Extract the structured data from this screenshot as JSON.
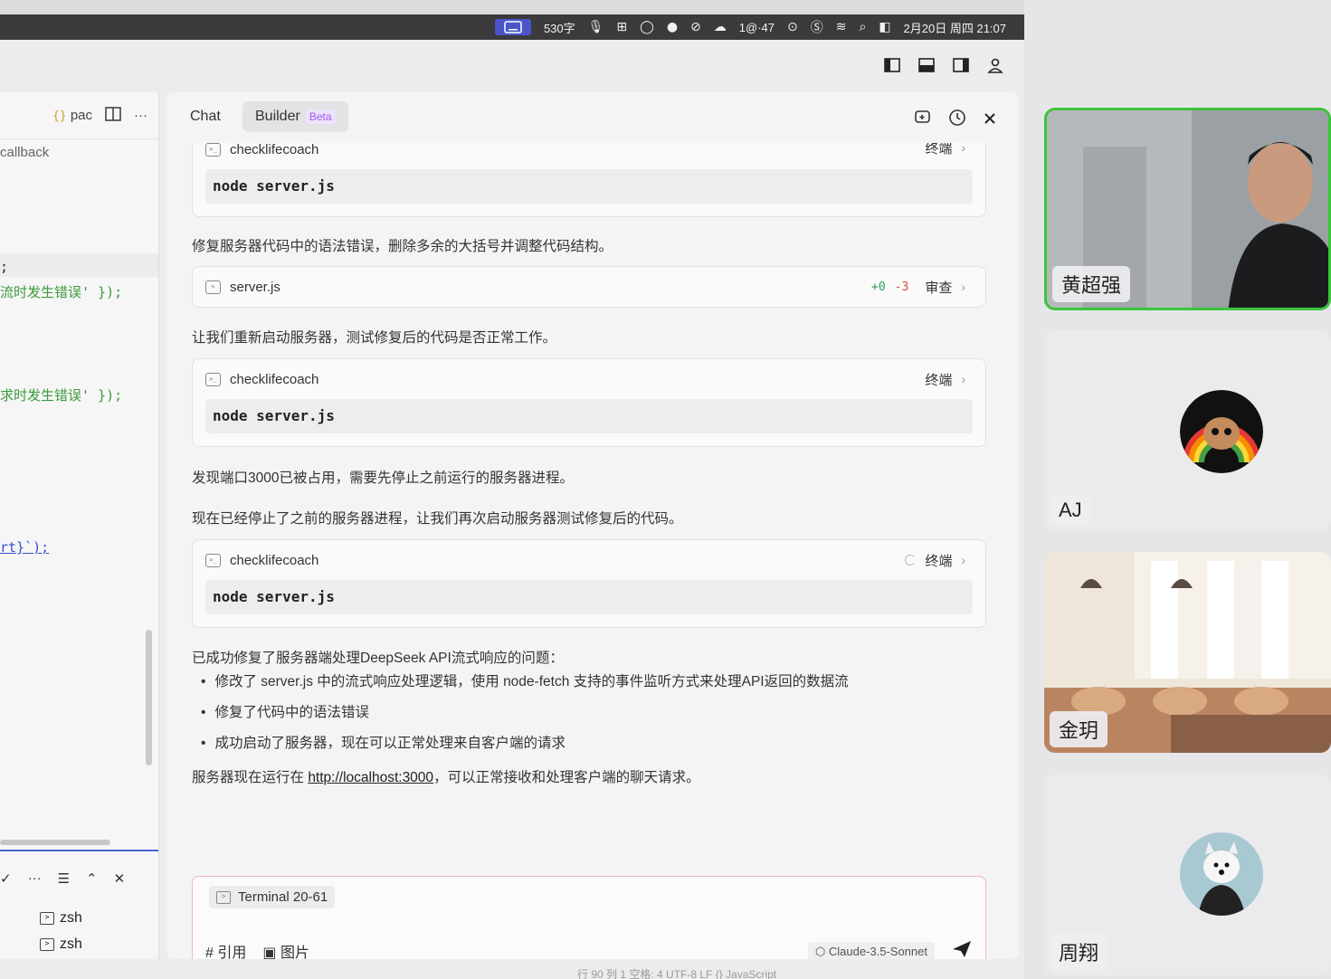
{
  "menubar": {
    "ime_label": "",
    "char_count": "530字",
    "mail_count": "1@·47",
    "datetime": "2月20日 周四  21:07"
  },
  "editor": {
    "tab_label": "pac",
    "breadcrumb": "callback",
    "code_lines": [
      {
        "text": ";",
        "cls": ""
      },
      {
        "text": "流时发生错误' });",
        "cls": "str"
      },
      {
        "text": "求时发生错误' });",
        "cls": "str"
      },
      {
        "text": "rt}`);",
        "cls": "punc"
      }
    ],
    "terminals": [
      "zsh",
      "zsh"
    ]
  },
  "chat": {
    "tabs": {
      "chat": "Chat",
      "builder": "Builder",
      "beta": "Beta"
    },
    "card0": {
      "title": "checklifecoach",
      "action": "终端",
      "code": "node server.js"
    },
    "msg1": "修复服务器代码中的语法错误，删除多余的大括号并调整代码结构。",
    "card1": {
      "title": "server.js",
      "added": "+0",
      "removed": "-3",
      "action": "审查"
    },
    "msg2": "让我们重新启动服务器，测试修复后的代码是否正常工作。",
    "card2": {
      "title": "checklifecoach",
      "action": "终端",
      "code": "node server.js"
    },
    "msg3": "发现端口3000已被占用，需要先停止之前运行的服务器进程。",
    "msg4": "现在已经停止了之前的服务器进程，让我们再次启动服务器测试修复后的代码。",
    "card3": {
      "title": "checklifecoach",
      "action": "终端",
      "code": "node server.js"
    },
    "summary_title": "已成功修复了服务器端处理DeepSeek API流式响应的问题：",
    "bullets": [
      "修改了 server.js 中的流式响应处理逻辑，使用 node-fetch 支持的事件监听方式来处理API返回的数据流",
      "修复了代码中的语法错误",
      "成功启动了服务器，现在可以正常处理来自客户端的请求"
    ],
    "final_prefix": "服务器现在运行在 ",
    "final_link": "http://localhost:3000",
    "final_suffix": "，可以正常接收和处理客户端的聊天请求。"
  },
  "input": {
    "chip": "Terminal 20-61",
    "quote": "# 引用",
    "image": "图片",
    "model": "Claude-3.5-Sonnet"
  },
  "statusbar": "行 90  列 1  空格: 4  UTF-8  LF  {} JavaScript",
  "participants": [
    {
      "name": "黄超强",
      "active": true
    },
    {
      "name": "AJ",
      "active": false
    },
    {
      "name": "金玥",
      "active": false
    },
    {
      "name": "周翔",
      "active": false
    }
  ],
  "colors": {
    "active_border": "#3cc43c",
    "beta": "#a855f7",
    "add": "#2c9f5b",
    "del": "#d84a3c"
  }
}
